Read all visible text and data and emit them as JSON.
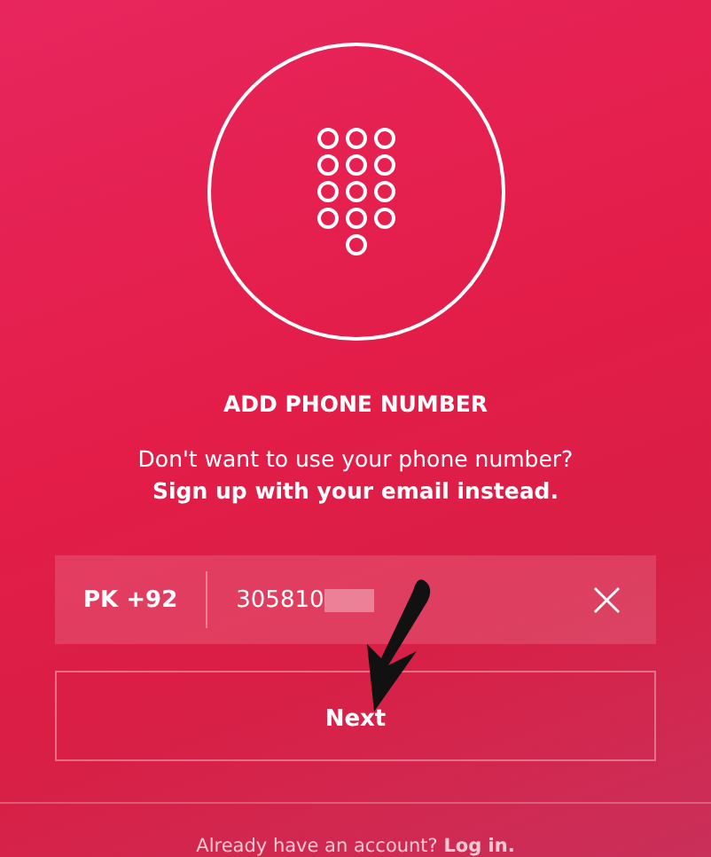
{
  "title": "ADD PHONE NUMBER",
  "subtitle": "Don't want to use your phone number?",
  "email_link": "Sign up with your email instead.",
  "phone_field": {
    "country_code": "PK +92",
    "value": "305810",
    "clear": "×"
  },
  "next_button": "Next",
  "footer": {
    "text": "Already have an account?",
    "link": "Log in."
  }
}
